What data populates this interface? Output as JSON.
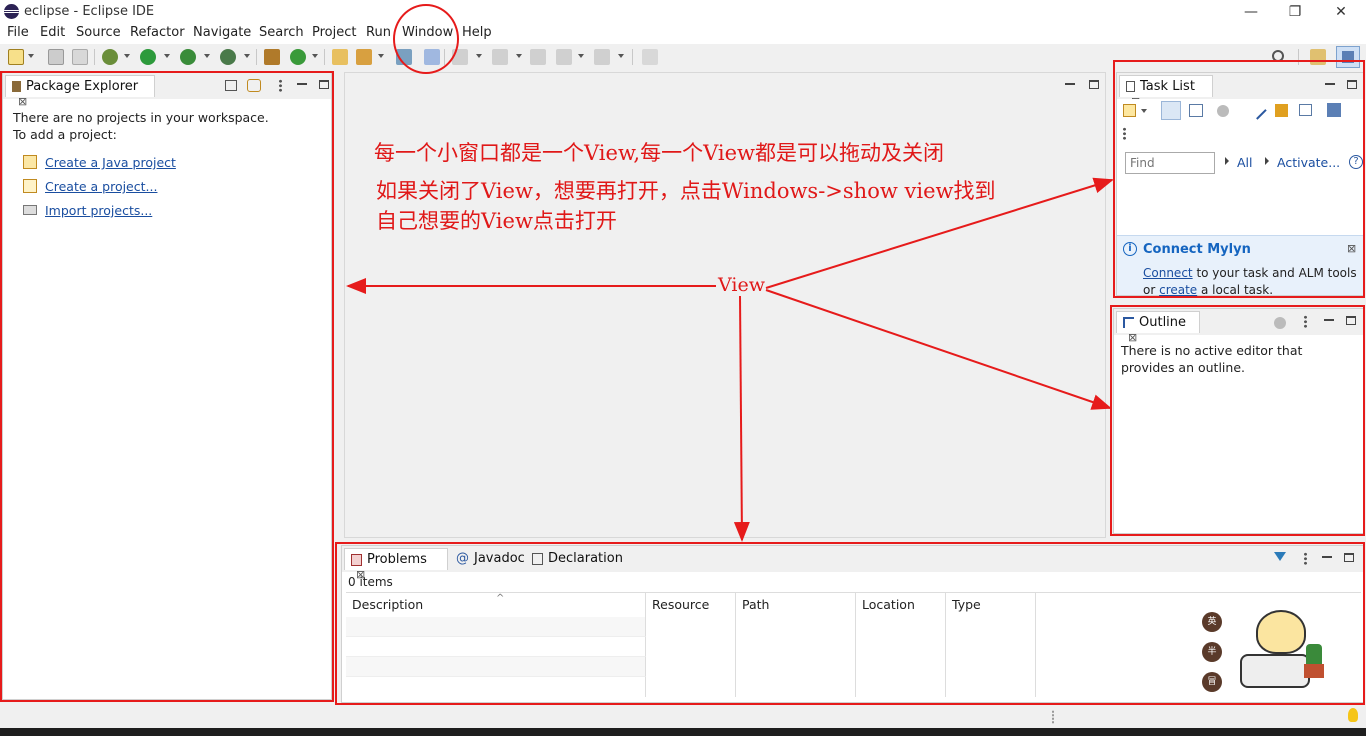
{
  "window": {
    "title": "eclipse - Eclipse IDE",
    "minimize": "—",
    "restore": "❐",
    "close": "✕"
  },
  "menu": [
    "File",
    "Edit",
    "Source",
    "Refactor",
    "Navigate",
    "Search",
    "Project",
    "Run",
    "Window",
    "Help"
  ],
  "package_explorer": {
    "tab": "Package Explorer",
    "line1": "There are no projects in your workspace.",
    "line2": "To add a project:",
    "links": [
      "Create a Java project",
      "Create a project...",
      "Import projects..."
    ]
  },
  "task_list": {
    "tab": "Task List",
    "find_placeholder": "Find",
    "all": "All",
    "activate": "Activate...",
    "help": "?",
    "mylyn_title": "Connect Mylyn",
    "mylyn_connect": "Connect",
    "mylyn_text1": " to your task and ALM tools",
    "mylyn_or": "or ",
    "mylyn_create": "create",
    "mylyn_text2": " a local task."
  },
  "outline": {
    "tab": "Outline",
    "message": "There is no active editor that provides an outline."
  },
  "problems": {
    "tabs": [
      "Problems",
      "Javadoc",
      "Declaration"
    ],
    "count": "0 items",
    "columns": [
      "Description",
      "Resource",
      "Path",
      "Location",
      "Type"
    ]
  },
  "annotations": {
    "line1": "每一个小窗口都是一个View,每一个View都是可以拖动及关闭",
    "line2": "如果关闭了View，想要再打开，点击Windows->show view找到",
    "line3": "自己想要的View点击打开",
    "view_label": "View"
  },
  "sticker": {
    "badges": [
      "英",
      "半",
      "冒"
    ]
  },
  "colors": {
    "annotation_red": "#e61b1b",
    "link_blue": "#1a4ea0",
    "mylyn_blue": "#1565c0"
  }
}
